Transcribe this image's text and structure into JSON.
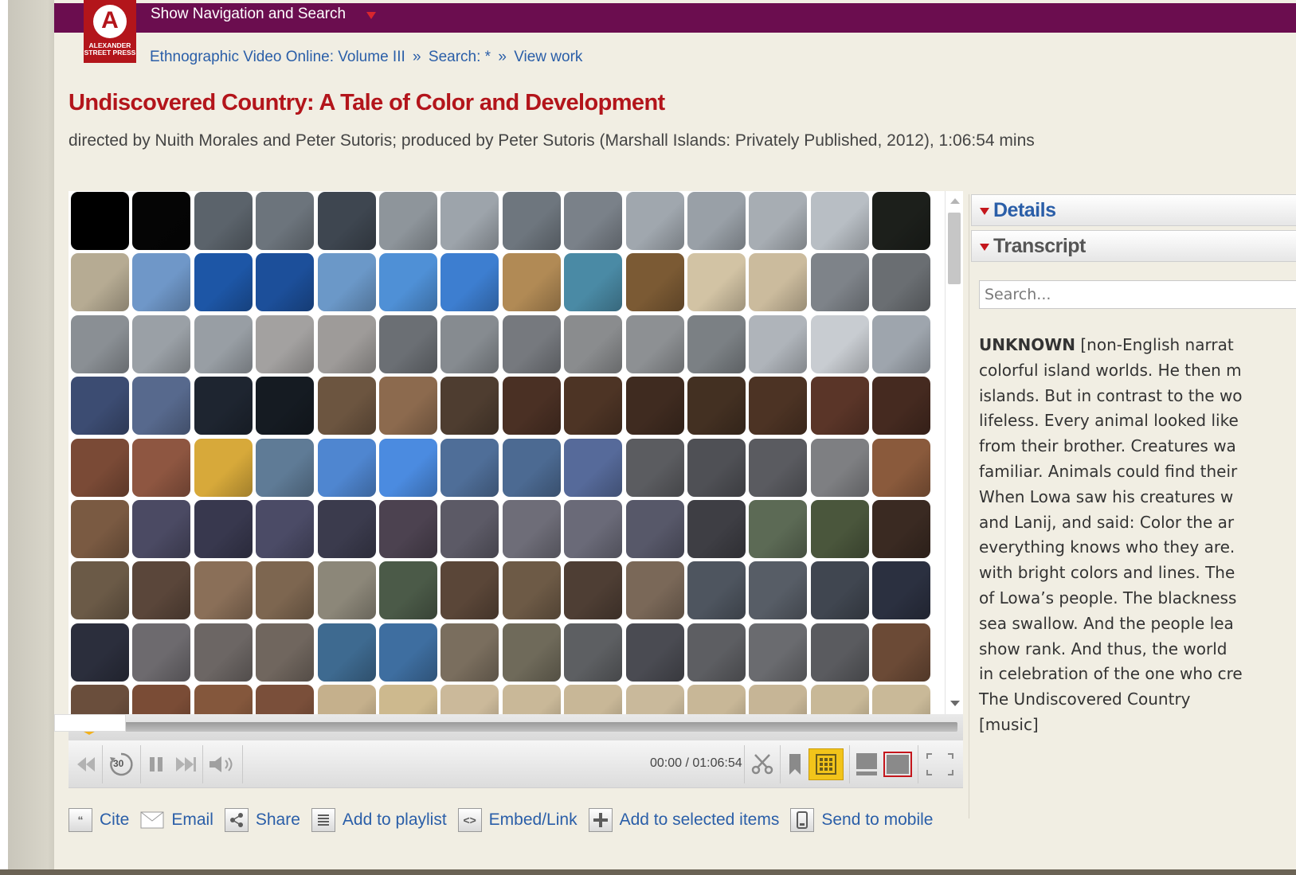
{
  "topbar": {
    "label": "Show Navigation and Search"
  },
  "logo": {
    "letter": "A",
    "text_line1": "ALEXANDER",
    "text_line2": "STREET PRESS"
  },
  "breadcrumb": {
    "items": [
      "Ethnographic Video Online: Volume III",
      "Search: *",
      "View work"
    ],
    "separator": "»"
  },
  "work": {
    "title": "Undiscovered Country: A Tale of Color and Development",
    "subtitle": "directed by Nuith Morales and Peter Sutoris; produced by Peter Sutoris (Marshall Islands: Privately Published, 2012), 1:06:54 mins"
  },
  "player": {
    "time": "00:00 / 01:06:54",
    "skip_seconds": "30",
    "thumbnail_colors": [
      "#000000",
      "#050505",
      "#5b636b",
      "#6c747c",
      "#3e4650",
      "#8e959b",
      "#9da4ab",
      "#6e767e",
      "#7a8189",
      "#a0a7ae",
      "#99a0a7",
      "#a7adb3",
      "#b8bec4",
      "#1c1f1b",
      "#b6ab93",
      "#6f97c8",
      "#1d56a6",
      "#1c4f9a",
      "#6b98c8",
      "#4f90d6",
      "#3d7ed0",
      "#b18a55",
      "#4a8aa5",
      "#7b5a34",
      "#d2c3a4",
      "#cbbb9d",
      "#7e8389",
      "#6a6e72",
      "#8a8f94",
      "#9aa0a6",
      "#989ea4",
      "#a3a1a0",
      "#9e9b99",
      "#6b6f74",
      "#868b90",
      "#76797e",
      "#8a8c8e",
      "#8d9093",
      "#7b8084",
      "#afb4ba",
      "#c8ccd1",
      "#9ea5ad",
      "#3c4c72",
      "#57698d",
      "#1e2530",
      "#151b22",
      "#6c5540",
      "#8c6a4e",
      "#4e3d30",
      "#4a3024",
      "#4d3425",
      "#3f2b20",
      "#433022",
      "#4c3324",
      "#5a3528",
      "#452a20",
      "#7a4a36",
      "#8e5641",
      "#d7a93a",
      "#5f7b96",
      "#4f86d0",
      "#4b8be0",
      "#4f6e98",
      "#4c6a92",
      "#566a9a",
      "#5b5c60",
      "#4f5055",
      "#5a5b60",
      "#7e7f82",
      "#8a5a3c",
      "#7a5a42",
      "#4b4a63",
      "#38384e",
      "#4b4b66",
      "#3b3b4d",
      "#4c4250",
      "#5c5a66",
      "#6e6d78",
      "#6a6a78",
      "#575869",
      "#3e3e44",
      "#5c6a55",
      "#4a563c",
      "#3a2a22",
      "#6b5a47",
      "#5a463a",
      "#8a6f58",
      "#7d6650",
      "#8c8779",
      "#4b5a48",
      "#5a4638",
      "#6d5a46",
      "#4e3e34",
      "#7a6858",
      "#4e555f",
      "#575d66",
      "#404650",
      "#2b3040",
      "#2b2e3c",
      "#6d6a6e",
      "#6c6664",
      "#70665e",
      "#3e6a90",
      "#3e6ea0",
      "#7a6e5e",
      "#6f6a5a",
      "#5d5f62",
      "#4a4b52",
      "#5d5e62",
      "#6a6b6f",
      "#5a5b5f",
      "#6b4a36",
      "#6a4e3c",
      "#7a4c36",
      "#84573c",
      "#7a4f3a",
      "#c5b08c",
      "#cdb98e",
      "#cbb99a",
      "#c9b898",
      "#c8b797",
      "#c9b99b",
      "#c8b797",
      "#c6b596",
      "#c8b897",
      "#c9b998"
    ]
  },
  "side_panel": {
    "details_label": "Details",
    "transcript_label": "Transcript",
    "search_placeholder": "Search...",
    "transcript": {
      "speaker": "UNKNOWN",
      "lines": [
        " [non-English narrat",
        "colorful island worlds. He then m",
        "islands. But in contrast to the wo",
        "lifeless. Every animal looked like",
        "from their brother. Creatures wa",
        "familiar. Animals could find their",
        "When Lowa saw his creatures w",
        "and Lanij, and said: Color the ar",
        "everything knows who they are.",
        "with bright colors and lines. The",
        "of Lowa’s people. The blackness",
        "sea swallow. And the people lea",
        "show rank. And thus, the world",
        "in celebration of the one who cre"
      ],
      "para2": "The Undiscovered Country",
      "para3": "[music]"
    }
  },
  "actions": [
    {
      "icon": "cite-icon",
      "label": "Cite"
    },
    {
      "icon": "email-icon",
      "label": "Email"
    },
    {
      "icon": "share-icon",
      "label": "Share"
    },
    {
      "icon": "playlist-icon",
      "label": "Add to playlist"
    },
    {
      "icon": "embed-icon",
      "label": "Embed/Link"
    },
    {
      "icon": "add-selected-icon",
      "label": "Add to selected items"
    },
    {
      "icon": "mobile-icon",
      "label": "Send to mobile"
    }
  ],
  "colors": {
    "topbar": "#6b0d4f",
    "title": "#b3151b",
    "link": "#2a5ea8",
    "page_bg": "#f1eee3"
  }
}
